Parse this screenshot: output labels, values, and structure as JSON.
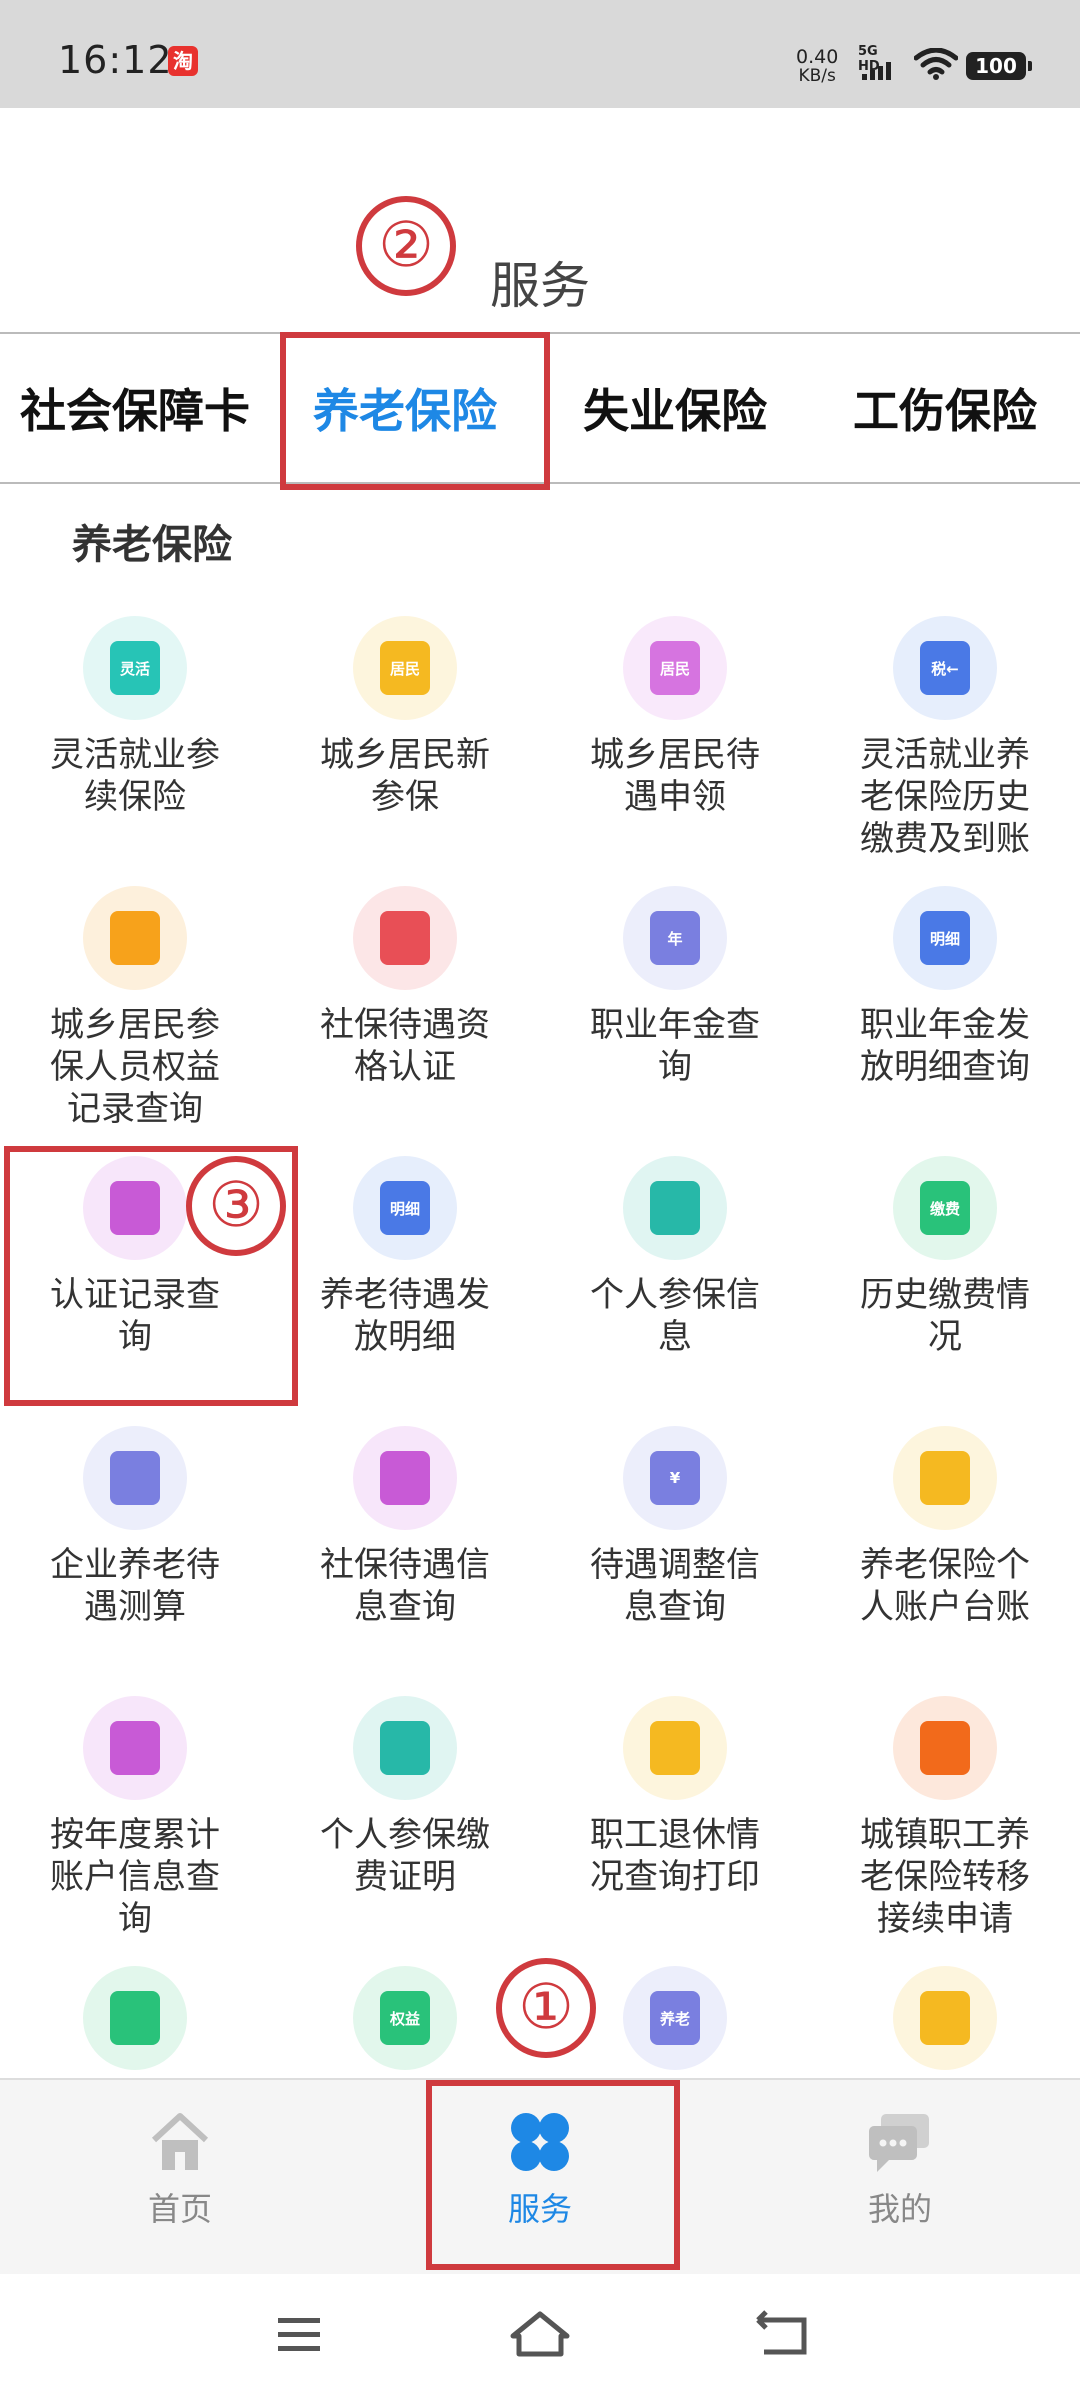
{
  "status_bar": {
    "time": "16:12",
    "app_notification": "淘",
    "net_speed_value": "0.40",
    "net_speed_unit": "KB/s",
    "signal_label": "5G HD",
    "battery": "100"
  },
  "header": {
    "title": "服务"
  },
  "tabs": [
    {
      "label": "社会保障卡"
    },
    {
      "label": "养老保险"
    },
    {
      "label": "失业保险"
    },
    {
      "label": "工伤保险"
    }
  ],
  "active_tab": "养老保险",
  "section": {
    "title": "养老保险"
  },
  "grid_items": [
    {
      "label": "灵活就业参续保险",
      "icon": "flexible-employment-icon",
      "icon_text": "灵活",
      "color": "#27c4b6",
      "bg": "#e3f7f5"
    },
    {
      "label": "城乡居民新参保",
      "icon": "resident-new-insure-icon",
      "icon_text": "居民",
      "color": "#f5b921",
      "bg": "#fdf5dd"
    },
    {
      "label": "城乡居民待遇申领",
      "icon": "resident-benefit-claim-icon",
      "icon_text": "居民",
      "color": "#d674e0",
      "bg": "#f9e9fb"
    },
    {
      "label": "灵活就业养老保险历史缴费及到账",
      "icon": "tax-card-icon",
      "icon_text": "税←",
      "color": "#4a79e6",
      "bg": "#e6eefc"
    },
    {
      "label": "城乡居民参保人员权益记录查询",
      "icon": "bookmark-record-icon",
      "icon_text": "",
      "color": "#f7a21b",
      "bg": "#fdf0dc"
    },
    {
      "label": "社保待遇资格认证",
      "icon": "qualification-medal-icon",
      "icon_text": "",
      "color": "#e84f56",
      "bg": "#fce6e7"
    },
    {
      "label": "职业年金查询",
      "icon": "annuity-coins-icon",
      "icon_text": "年",
      "color": "#7a7fe0",
      "bg": "#eceefb"
    },
    {
      "label": "职业年金发放明细查询",
      "icon": "annuity-detail-icon",
      "icon_text": "明细",
      "color": "#4a79e6",
      "bg": "#e6eefc"
    },
    {
      "label": "认证记录查询",
      "icon": "certification-record-icon",
      "icon_text": "",
      "color": "#c85ad6",
      "bg": "#f7e6fa"
    },
    {
      "label": "养老待遇发放明细",
      "icon": "pension-detail-icon",
      "icon_text": "明细",
      "color": "#4a79e6",
      "bg": "#e6eefc"
    },
    {
      "label": "个人参保信息",
      "icon": "personal-insure-info-icon",
      "icon_text": "",
      "color": "#27b8a8",
      "bg": "#e0f5f2"
    },
    {
      "label": "历史缴费情况",
      "icon": "payment-history-icon",
      "icon_text": "缴费",
      "color": "#29c27a",
      "bg": "#e2f7ec"
    },
    {
      "label": "企业养老待遇测算",
      "icon": "pension-calculation-icon",
      "icon_text": "",
      "color": "#7a7fe0",
      "bg": "#eceefb"
    },
    {
      "label": "社保待遇信息查询",
      "icon": "benefit-info-icon",
      "icon_text": "",
      "color": "#c85ad6",
      "bg": "#f7e6fa"
    },
    {
      "label": "待遇调整信息查询",
      "icon": "benefit-adjust-icon",
      "icon_text": "¥",
      "color": "#7a7fe0",
      "bg": "#eceefb"
    },
    {
      "label": "养老保险个人账户台账",
      "icon": "personal-account-ledger-icon",
      "icon_text": "",
      "color": "#f5b921",
      "bg": "#fdf5dd"
    },
    {
      "label": "按年度累计账户信息查询",
      "icon": "annual-account-query-icon",
      "icon_text": "",
      "color": "#c85ad6",
      "bg": "#f7e6fa"
    },
    {
      "label": "个人参保缴费证明",
      "icon": "payment-certificate-icon",
      "icon_text": "",
      "color": "#27b8a8",
      "bg": "#e0f5f2"
    },
    {
      "label": "职工退休情况查询打印",
      "icon": "retirement-query-icon",
      "icon_text": "",
      "color": "#f5b921",
      "bg": "#fdf5dd"
    },
    {
      "label": "城镇职工养老保险转移接续申请",
      "icon": "transfer-application-icon",
      "icon_text": "",
      "color": "#f26a1b",
      "bg": "#fde8dc"
    },
    {
      "label": "",
      "icon": "partial-transfer-icon",
      "icon_text": "",
      "color": "#29c27a",
      "bg": "#e2f7ec"
    },
    {
      "label": "",
      "icon": "rights-print-icon",
      "icon_text": "权益",
      "color": "#29c27a",
      "bg": "#e2f7ec"
    },
    {
      "label": "",
      "icon": "pension-forward-icon",
      "icon_text": "养老",
      "color": "#7a7fe0",
      "bg": "#eceefb"
    },
    {
      "label": "",
      "icon": "record-search-icon",
      "icon_text": "",
      "color": "#f5b921",
      "bg": "#fdf5dd"
    }
  ],
  "bottom_nav": [
    {
      "label": "首页",
      "icon": "home-icon"
    },
    {
      "label": "服务",
      "icon": "service-grid-icon"
    },
    {
      "label": "我的",
      "icon": "chat-bubble-icon"
    }
  ],
  "annotations": {
    "step1": "①",
    "step2": "②",
    "step3": "③"
  },
  "accent_color": "#1e88e5",
  "annotation_color": "#cf3a3e"
}
